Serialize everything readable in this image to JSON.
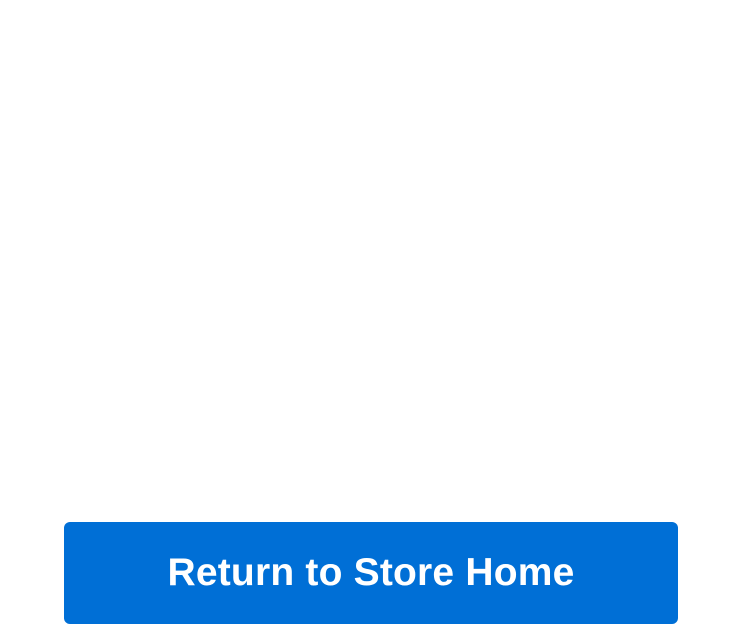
{
  "actions": {
    "return_label": "Return to Store Home"
  },
  "colors": {
    "background": "#ffffff",
    "primary_button": "#006fd6",
    "primary_button_text": "#ffffff"
  }
}
